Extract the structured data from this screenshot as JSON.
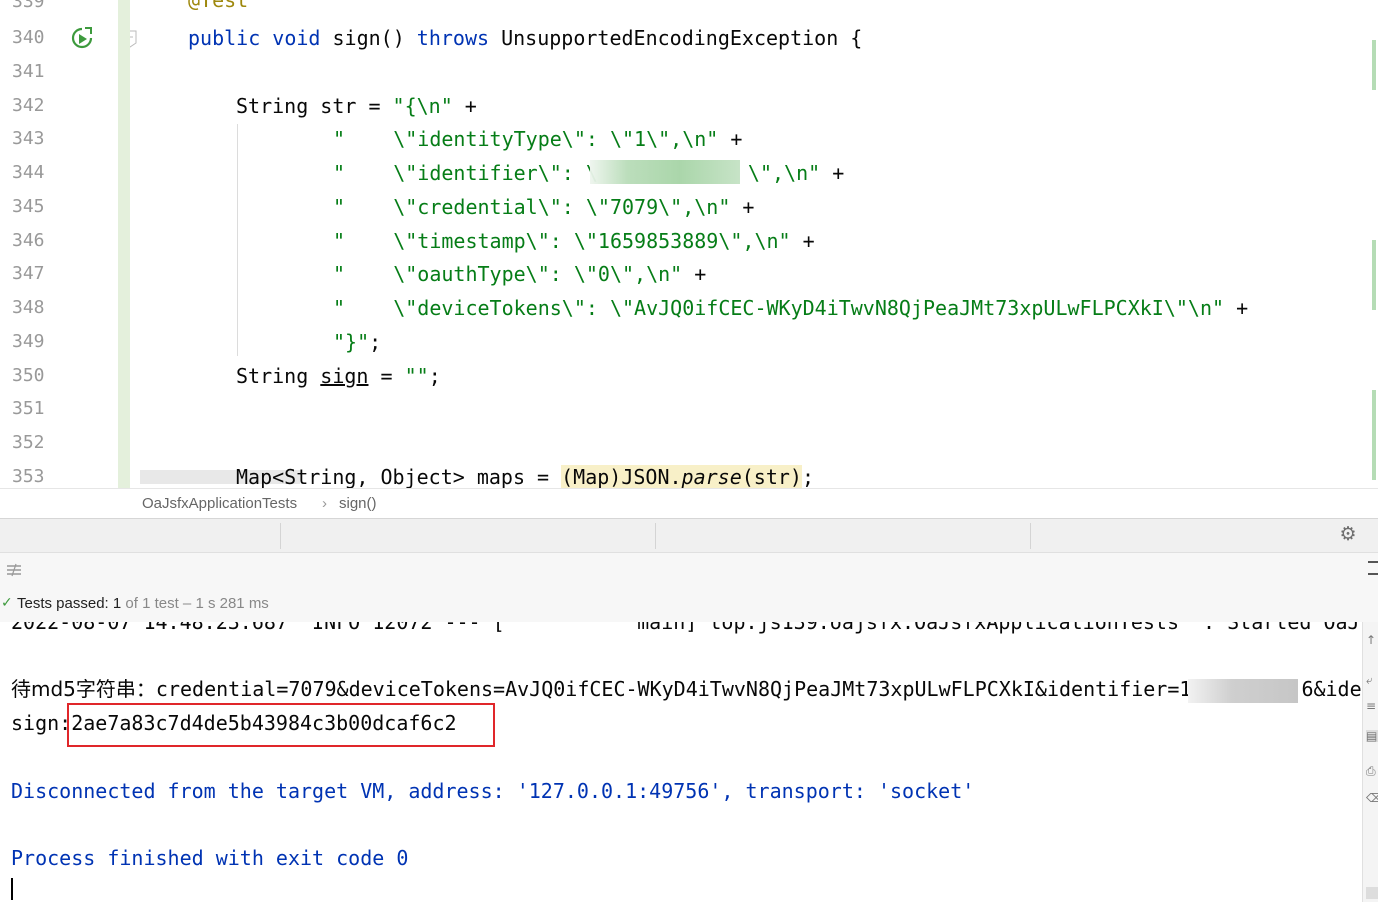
{
  "editor": {
    "line_numbers": [
      "339",
      "340",
      "341",
      "342",
      "343",
      "344",
      "345",
      "346",
      "347",
      "348",
      "349",
      "350",
      "351",
      "352",
      "353"
    ],
    "annotation_partial": "@Test",
    "line340": {
      "kw1": "public",
      "kw2": "void",
      "name": " sign() ",
      "kw3": "throws",
      "rest": " UnsupportedEncodingException {"
    },
    "line342": {
      "pre": "String str = ",
      "str": "\"{\\n\"",
      "post": " +"
    },
    "line343": {
      "q": "\"",
      "str": "    \\\"identityType\\\": \\\"1\\\",\\n\"",
      "post": " +"
    },
    "line344": {
      "q": "\"",
      "str": "    \\\"identifier\\\": \\",
      "tail": "\\\",\\n\"",
      "post": " +"
    },
    "line345": {
      "q": "\"",
      "str": "    \\\"credential\\\": \\\"7079\\\",\\n\"",
      "post": " +"
    },
    "line346": {
      "q": "\"",
      "str": "    \\\"timestamp\\\": \\\"1659853889\\\",\\n\"",
      "post": " +"
    },
    "line347": {
      "q": "\"",
      "str": "    \\\"oauthType\\\": \\\"0\\\",\\n\"",
      "post": " +"
    },
    "line348": {
      "q": "\"",
      "str": "    \\\"deviceTokens\\\": \\\"AvJQ0ifCEC-WKyD4iTwvN8QjPeaJMt73xpULwFLPCXkI\\\"\\n\"",
      "post": " +"
    },
    "line349": {
      "str": "\"}\"",
      "post": ";"
    },
    "line350": {
      "pre": "String ",
      "var": "sign",
      "mid": " = ",
      "str": "\"\"",
      "post": ";"
    },
    "line353": {
      "pre": "Map<String, Object> maps = ",
      "cast": "(Map)JSON.",
      "method": "parse",
      "args": "(str)",
      "post": ";"
    }
  },
  "breadcrumb": {
    "class_name": "OaJsfxApplicationTests",
    "sep": "›",
    "method": "sign()"
  },
  "run_panel": {
    "status": {
      "check": "✓",
      "label": "Tests passed: ",
      "count": "1",
      "detail": " of 1 test – 1 s 281 ms"
    },
    "console": {
      "line_cut": "2022-08-07 14:48:23.687  INFO 12072 --- [           main] top.js139.oajsfx.OaJsfxApplicationTests  : Started OaJ",
      "md5_prefix": "待md5字符串：",
      "md5_text": "credential=7079&deviceTokens=AvJQ0ifCEC-WKyD4iTwvN8QjPeaJMt73xpULwFLPCXkI&identifier=1",
      "md5_tail": "6&ide",
      "sign_label": "sign:",
      "sign_value": "2ae7a83c7d4de5b43984c3b00dcaf6c2",
      "disconnected": "Disconnected from the target VM, address: '127.0.0.1:49756', transport: 'socket'",
      "finished": "Process finished with exit code 0"
    }
  },
  "colors": {
    "keyword": "#0033b3",
    "string": "#067d17",
    "highlight_box": "#e0262a",
    "pass_green": "#3d9a3d"
  },
  "icons": [
    "run-test-icon",
    "bookmark-icon",
    "gear-icon",
    "toolbar-icon",
    "pass-check-icon"
  ]
}
